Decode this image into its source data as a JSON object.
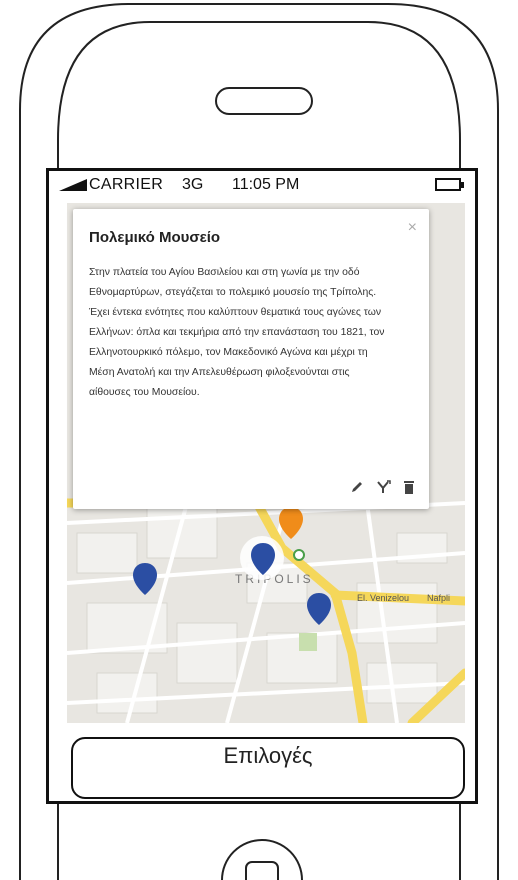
{
  "status_bar": {
    "carrier": "CARRIER",
    "network": "3G",
    "time": "11:05 PM"
  },
  "map": {
    "city_label": "TRIPOLIS",
    "street_labels": [
      "Εl. Venizelou",
      "Nafpli"
    ]
  },
  "popup": {
    "title": "Πολεμικό Μουσείο",
    "close_label": "×",
    "body": "Στην πλατεία του Αγίου Βασιλείου και στη γωνία με την οδό Εθνομαρτύρων, στεγάζεται το πολεμικό μουσείο της Τρίπολης. Έχει έντεκα ενότητες που καλύπτουν θεματικά τους αγώνες των Ελλήνων: όπλα και τεκμήρια από την επανάσταση του 1821, τον Ελληνοτουρκικό πόλεμο, τον Μακεδονικό Αγώνα και μέχρι τη Μέση Ανατολή και την Απελευθέρωση φιλοξενούνται στις αίθουσες του Μουσείου.",
    "actions": [
      "pencil-icon",
      "directions-icon",
      "trash-icon"
    ]
  },
  "options_button": {
    "label": "Επιλογές"
  },
  "colors": {
    "marker_blue": "#2b4ea3",
    "marker_orange": "#f08c1a",
    "road_yellow": "#f5d75a",
    "map_bg": "#e8e6e1"
  }
}
